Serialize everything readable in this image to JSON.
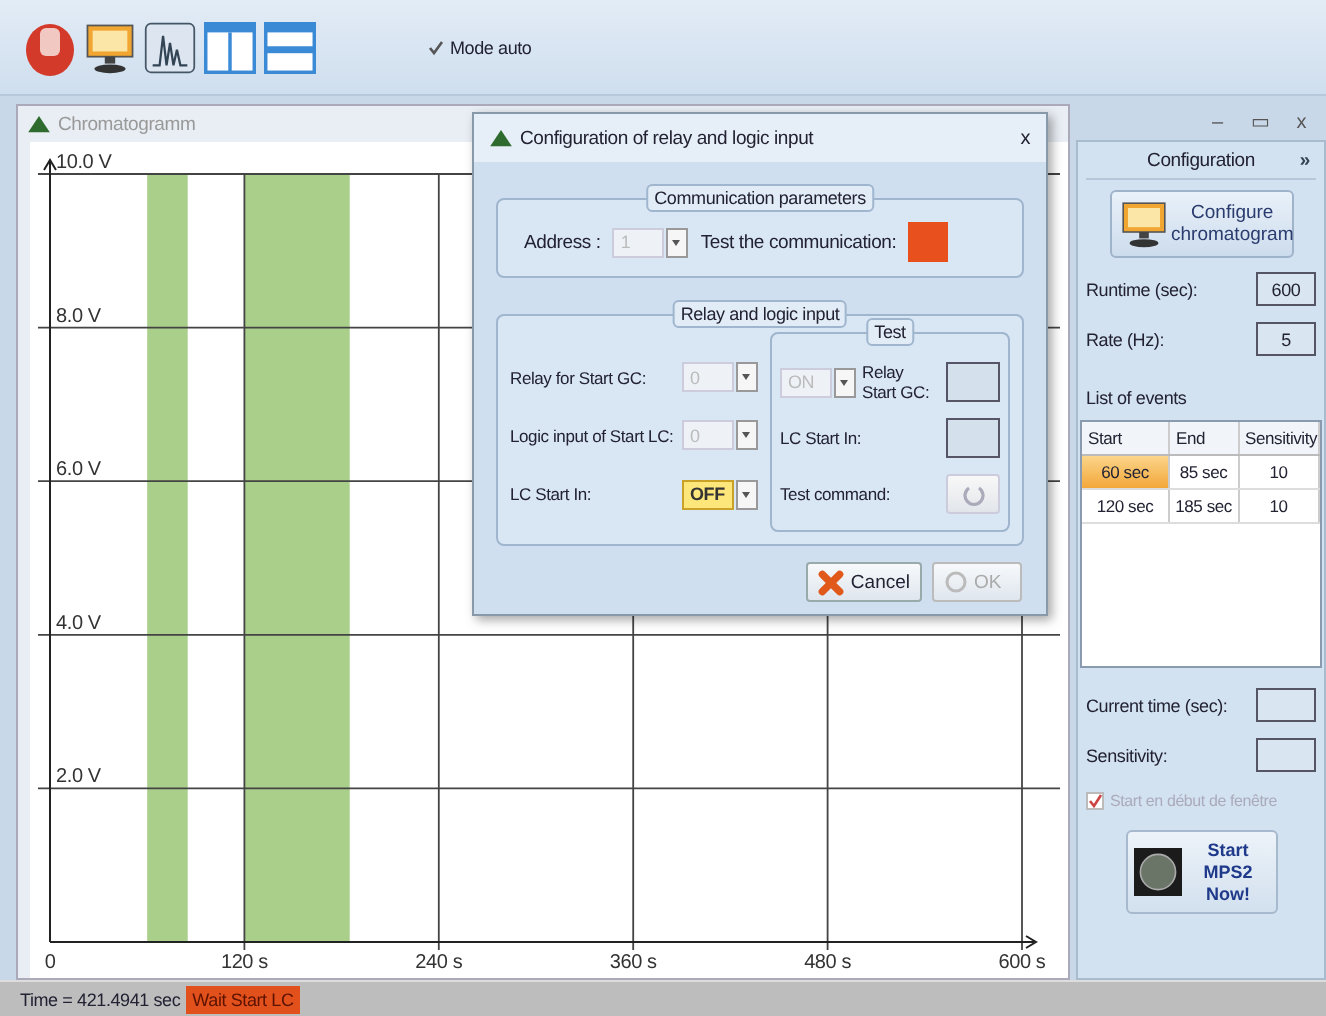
{
  "toolbar": {
    "tools": [
      {
        "kind": "stop"
      },
      {
        "kind": "monitor"
      },
      {
        "kind": "peaks"
      },
      {
        "kind": "columns"
      },
      {
        "kind": "rows"
      }
    ],
    "mode_auto": {
      "label": "Mode auto",
      "checked": true
    }
  },
  "chromatogram": {
    "title": "Chromatogramm",
    "chart_data": {
      "type": "area",
      "xlim": [
        0,
        600
      ],
      "ylim": [
        0,
        10
      ],
      "xticks": [
        {
          "value": 0,
          "label": "0"
        },
        {
          "value": 120,
          "label": "120 s"
        },
        {
          "value": 240,
          "label": "240 s"
        },
        {
          "value": 360,
          "label": "360 s"
        },
        {
          "value": 480,
          "label": "480 s"
        },
        {
          "value": 600,
          "label": "600 s"
        }
      ],
      "yticks": [
        {
          "value": 2,
          "label": "2.0 V"
        },
        {
          "value": 4,
          "label": "4.0 V"
        },
        {
          "value": 6,
          "label": "6.0 V"
        },
        {
          "value": 8,
          "label": "8.0 V"
        },
        {
          "value": 10,
          "label": "10.0 V"
        }
      ],
      "grid": true,
      "x": [
        0,
        60,
        60,
        85,
        85,
        120,
        120,
        185,
        185,
        600
      ],
      "series": [
        {
          "color": "#a9cf8b",
          "values": [
            0,
            0,
            10,
            10,
            0,
            0,
            10,
            10,
            0,
            0
          ]
        }
      ]
    }
  },
  "dialog": {
    "title": "Configuration of relay and logic input",
    "close": "x",
    "communication": {
      "title": "Communication parameters",
      "address_label": "Address :",
      "address": {
        "value": "1",
        "disabled": true
      },
      "test_label": "Test the communication:",
      "test_on": true
    },
    "relay": {
      "title": "Relay and logic input",
      "fields": [
        {
          "label": "Relay for Start GC:",
          "value": "0",
          "disabled": true,
          "highlighted": false
        },
        {
          "label": "Logic input of Start LC:",
          "value": "0",
          "disabled": true,
          "highlighted": false
        },
        {
          "label": "LC Start In:",
          "value": "OFF",
          "disabled": false,
          "highlighted": true
        }
      ],
      "test": {
        "title": "Test",
        "relay_combo": {
          "value": "ON",
          "disabled": true
        },
        "relay_label": "Relay Start GC:",
        "relay_on": false,
        "lc_label": "LC Start In:",
        "lc_on": false,
        "command_label": "Test command:"
      }
    },
    "buttons": [
      {
        "kind": "cancel",
        "label": "Cancel",
        "disabled": false
      },
      {
        "kind": "ok",
        "label": "OK",
        "disabled": true
      }
    ]
  },
  "window_controls": [
    "–",
    "▭",
    "x"
  ],
  "config": {
    "title": "Configuration",
    "collapse": "»",
    "configure_button": "Configure chromatogram",
    "runtime_label": "Runtime (sec):",
    "runtime": "600",
    "rate_label": "Rate (Hz):",
    "rate": "5",
    "events_label": "List of events",
    "columns": [
      "Start",
      "End",
      "Sensitivity"
    ],
    "events": [
      {
        "cells": [
          "60 sec",
          "85 sec",
          "10"
        ],
        "selected": true
      },
      {
        "cells": [
          "120 sec",
          "185 sec",
          "10"
        ],
        "selected": false
      }
    ],
    "current_time_label": "Current time (sec):",
    "sensitivity_label": "Sensitivity:",
    "start_window": {
      "label": "Start en début de fenêtre",
      "checked": true,
      "disabled": true
    },
    "start_button": "Start MPS2 Now!"
  },
  "status_bar": {
    "time": "Time = 421.4941 sec",
    "state": "Wait Start LC"
  }
}
